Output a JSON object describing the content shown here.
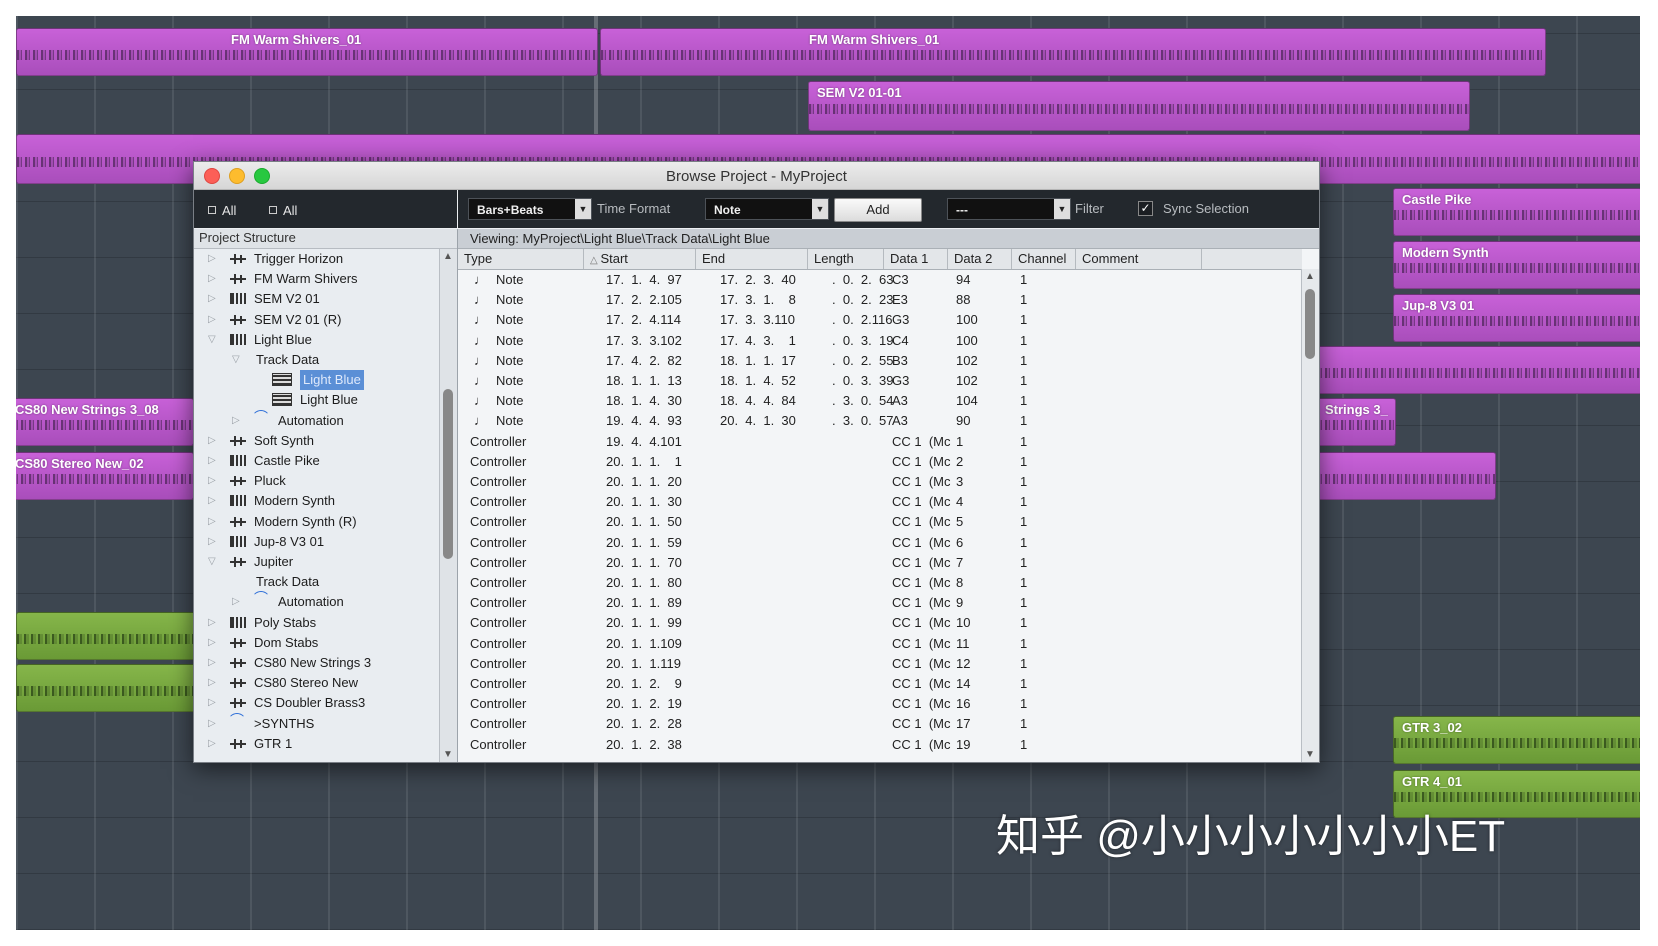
{
  "daw": {
    "clips": [
      {
        "label": "FM Warm Shivers_01",
        "color": "#b957c9"
      },
      {
        "label": "FM Warm Shivers_01",
        "color": "#b957c9"
      },
      {
        "label": "SEM V2 01-01",
        "color": "#b957c9"
      },
      {
        "label": "Castle Pike",
        "color": "#b957c9"
      },
      {
        "label": "Modern Synth",
        "color": "#b957c9"
      },
      {
        "label": "Jup-8 V3 01",
        "color": "#b957c9"
      },
      {
        "label": "CS80 New Strings 3_08",
        "color": "#b957c9"
      },
      {
        "label": "CS80 Stereo New_02",
        "color": "#b957c9"
      },
      {
        "label": "Strings 3_",
        "color": "#b957c9"
      },
      {
        "label": "GTR 3_02",
        "color": "#7aa842"
      },
      {
        "label": "GTR 4_01",
        "color": "#7aa842"
      }
    ]
  },
  "window": {
    "title": "Browse Project - MyProject",
    "toolbar": {
      "all_1": "All",
      "all_2": "All",
      "time_format_value": "Bars+Beats",
      "time_format_label": "Time Format",
      "event_type_value": "Note",
      "add_label": "Add",
      "filter_value": "---",
      "filter_label": "Filter",
      "sync_selection_label": "Sync Selection",
      "sync_selection_checked": true
    },
    "tree": {
      "header": "Project Structure",
      "items": [
        {
          "label": "Trigger Horizon",
          "icon": "audio-track-icon",
          "disclosure": "▷"
        },
        {
          "label": "FM Warm Shivers",
          "icon": "audio-track-icon",
          "disclosure": "▷"
        },
        {
          "label": "SEM V2 01",
          "icon": "midi-track-icon",
          "disclosure": "▷"
        },
        {
          "label": "SEM V2 01 (R)",
          "icon": "audio-track-icon",
          "disclosure": "▷"
        },
        {
          "label": "Light Blue",
          "icon": "midi-track-icon",
          "disclosure": "▽"
        },
        {
          "label": "Track Data",
          "icon": "",
          "disclosure": "▽"
        },
        {
          "label": "Light Blue",
          "icon": "midi-part-icon",
          "disclosure": "",
          "selected": true
        },
        {
          "label": "Light Blue",
          "icon": "midi-part-icon",
          "disclosure": ""
        },
        {
          "label": "Automation",
          "icon": "automation-icon",
          "disclosure": "▷"
        },
        {
          "label": "Soft Synth",
          "icon": "audio-track-icon",
          "disclosure": "▷"
        },
        {
          "label": "Castle Pike",
          "icon": "midi-track-icon",
          "disclosure": "▷"
        },
        {
          "label": "Pluck",
          "icon": "audio-track-icon",
          "disclosure": "▷"
        },
        {
          "label": "Modern Synth",
          "icon": "midi-track-icon",
          "disclosure": "▷"
        },
        {
          "label": "Modern Synth (R)",
          "icon": "audio-track-icon",
          "disclosure": "▷"
        },
        {
          "label": "Jup-8 V3 01",
          "icon": "midi-track-icon",
          "disclosure": "▷"
        },
        {
          "label": "Jupiter",
          "icon": "audio-track-icon",
          "disclosure": "▽"
        },
        {
          "label": "Track Data",
          "icon": "",
          "disclosure": ""
        },
        {
          "label": "Automation",
          "icon": "automation-icon",
          "disclosure": "▷"
        },
        {
          "label": "Poly Stabs",
          "icon": "midi-track-icon",
          "disclosure": "▷"
        },
        {
          "label": "Dom Stabs",
          "icon": "audio-track-icon",
          "disclosure": "▷"
        },
        {
          "label": "CS80 New Strings 3",
          "icon": "audio-track-icon",
          "disclosure": "▷"
        },
        {
          "label": "CS80 Stereo New",
          "icon": "audio-track-icon",
          "disclosure": "▷"
        },
        {
          "label": "CS Doubler Brass3",
          "icon": "audio-track-icon",
          "disclosure": "▷"
        },
        {
          "label": ">SYNTHS",
          "icon": "automation-icon",
          "disclosure": "▷"
        },
        {
          "label": "GTR 1",
          "icon": "audio-track-icon",
          "disclosure": "▷"
        }
      ]
    },
    "list": {
      "viewing": "Viewing: MyProject\\Light Blue\\Track Data\\Light Blue",
      "columns": [
        "Type",
        "Start",
        "End",
        "Length",
        "Data 1",
        "Data 2",
        "Channel",
        "Comment"
      ],
      "rows": [
        {
          "note": true,
          "type": "Note",
          "start": "17.  1.  4.  97",
          "end": "17.  2.  3.  40",
          "length": ".  0.  2.  63",
          "d1": "C3",
          "d2": "94",
          "ch": "1"
        },
        {
          "note": true,
          "type": "Note",
          "start": "17.  2.  2.105",
          "end": "17.  3.  1.    8",
          "length": ".  0.  2.  23",
          "d1": "E3",
          "d2": "88",
          "ch": "1"
        },
        {
          "note": true,
          "type": "Note",
          "start": "17.  2.  4.114",
          "end": "17.  3.  3.110",
          "length": ".  0.  2.116",
          "d1": "G3",
          "d2": "100",
          "ch": "1"
        },
        {
          "note": true,
          "type": "Note",
          "start": "17.  3.  3.102",
          "end": "17.  4.  3.    1",
          "length": ".  0.  3.  19",
          "d1": "C4",
          "d2": "100",
          "ch": "1"
        },
        {
          "note": true,
          "type": "Note",
          "start": "17.  4.  2.  82",
          "end": "18.  1.  1.  17",
          "length": ".  0.  2.  55",
          "d1": "B3",
          "d2": "102",
          "ch": "1"
        },
        {
          "note": true,
          "type": "Note",
          "start": "18.  1.  1.  13",
          "end": "18.  1.  4.  52",
          "length": ".  0.  3.  39",
          "d1": "G3",
          "d2": "102",
          "ch": "1"
        },
        {
          "note": true,
          "type": "Note",
          "start": "18.  1.  4.  30",
          "end": "18.  4.  4.  84",
          "length": ".  3.  0.  54",
          "d1": "A3",
          "d2": "104",
          "ch": "1"
        },
        {
          "note": true,
          "type": "Note",
          "start": "19.  4.  4.  93",
          "end": "20.  4.  1.  30",
          "length": ".  3.  0.  57",
          "d1": "A3",
          "d2": "90",
          "ch": "1"
        },
        {
          "note": false,
          "type": "Controller",
          "start": "19.  4.  4.101",
          "end": "",
          "length": "",
          "d1": "CC 1  (Mc",
          "d2": "1",
          "ch": "1"
        },
        {
          "note": false,
          "type": "Controller",
          "start": "20.  1.  1.    1",
          "end": "",
          "length": "",
          "d1": "CC 1  (Mc",
          "d2": "2",
          "ch": "1"
        },
        {
          "note": false,
          "type": "Controller",
          "start": "20.  1.  1.  20",
          "end": "",
          "length": "",
          "d1": "CC 1  (Mc",
          "d2": "3",
          "ch": "1"
        },
        {
          "note": false,
          "type": "Controller",
          "start": "20.  1.  1.  30",
          "end": "",
          "length": "",
          "d1": "CC 1  (Mc",
          "d2": "4",
          "ch": "1"
        },
        {
          "note": false,
          "type": "Controller",
          "start": "20.  1.  1.  50",
          "end": "",
          "length": "",
          "d1": "CC 1  (Mc",
          "d2": "5",
          "ch": "1"
        },
        {
          "note": false,
          "type": "Controller",
          "start": "20.  1.  1.  59",
          "end": "",
          "length": "",
          "d1": "CC 1  (Mc",
          "d2": "6",
          "ch": "1"
        },
        {
          "note": false,
          "type": "Controller",
          "start": "20.  1.  1.  70",
          "end": "",
          "length": "",
          "d1": "CC 1  (Mc",
          "d2": "7",
          "ch": "1"
        },
        {
          "note": false,
          "type": "Controller",
          "start": "20.  1.  1.  80",
          "end": "",
          "length": "",
          "d1": "CC 1  (Mc",
          "d2": "8",
          "ch": "1"
        },
        {
          "note": false,
          "type": "Controller",
          "start": "20.  1.  1.  89",
          "end": "",
          "length": "",
          "d1": "CC 1  (Mc",
          "d2": "9",
          "ch": "1"
        },
        {
          "note": false,
          "type": "Controller",
          "start": "20.  1.  1.  99",
          "end": "",
          "length": "",
          "d1": "CC 1  (Mc",
          "d2": "10",
          "ch": "1"
        },
        {
          "note": false,
          "type": "Controller",
          "start": "20.  1.  1.109",
          "end": "",
          "length": "",
          "d1": "CC 1  (Mc",
          "d2": "11",
          "ch": "1"
        },
        {
          "note": false,
          "type": "Controller",
          "start": "20.  1.  1.119",
          "end": "",
          "length": "",
          "d1": "CC 1  (Mc",
          "d2": "12",
          "ch": "1"
        },
        {
          "note": false,
          "type": "Controller",
          "start": "20.  1.  2.    9",
          "end": "",
          "length": "",
          "d1": "CC 1  (Mc",
          "d2": "14",
          "ch": "1"
        },
        {
          "note": false,
          "type": "Controller",
          "start": "20.  1.  2.  19",
          "end": "",
          "length": "",
          "d1": "CC 1  (Mc",
          "d2": "16",
          "ch": "1"
        },
        {
          "note": false,
          "type": "Controller",
          "start": "20.  1.  2.  28",
          "end": "",
          "length": "",
          "d1": "CC 1  (Mc",
          "d2": "17",
          "ch": "1"
        },
        {
          "note": false,
          "type": "Controller",
          "start": "20.  1.  2.  38",
          "end": "",
          "length": "",
          "d1": "CC 1  (Mc",
          "d2": "19",
          "ch": "1"
        }
      ]
    }
  },
  "watermark": "知乎 @小小小小小小小ET"
}
